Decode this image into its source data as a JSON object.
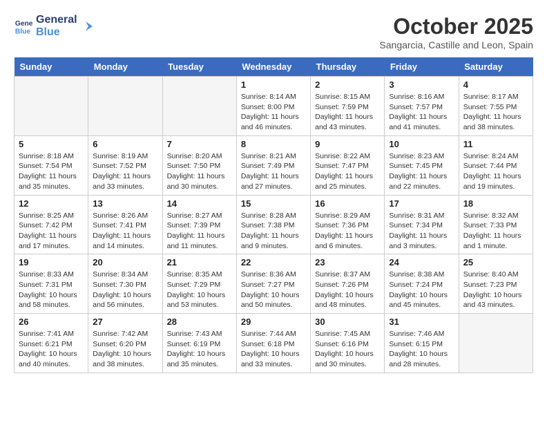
{
  "header": {
    "logo_line1": "General",
    "logo_line2": "Blue",
    "month_year": "October 2025",
    "location": "Sangarcia, Castille and Leon, Spain"
  },
  "weekdays": [
    "Sunday",
    "Monday",
    "Tuesday",
    "Wednesday",
    "Thursday",
    "Friday",
    "Saturday"
  ],
  "weeks": [
    [
      {
        "day": "",
        "empty": true
      },
      {
        "day": "",
        "empty": true
      },
      {
        "day": "",
        "empty": true
      },
      {
        "day": "1",
        "sunrise": "8:14 AM",
        "sunset": "8:00 PM",
        "daylight": "11 hours and 46 minutes."
      },
      {
        "day": "2",
        "sunrise": "8:15 AM",
        "sunset": "7:59 PM",
        "daylight": "11 hours and 43 minutes."
      },
      {
        "day": "3",
        "sunrise": "8:16 AM",
        "sunset": "7:57 PM",
        "daylight": "11 hours and 41 minutes."
      },
      {
        "day": "4",
        "sunrise": "8:17 AM",
        "sunset": "7:55 PM",
        "daylight": "11 hours and 38 minutes."
      }
    ],
    [
      {
        "day": "5",
        "sunrise": "8:18 AM",
        "sunset": "7:54 PM",
        "daylight": "11 hours and 35 minutes."
      },
      {
        "day": "6",
        "sunrise": "8:19 AM",
        "sunset": "7:52 PM",
        "daylight": "11 hours and 33 minutes."
      },
      {
        "day": "7",
        "sunrise": "8:20 AM",
        "sunset": "7:50 PM",
        "daylight": "11 hours and 30 minutes."
      },
      {
        "day": "8",
        "sunrise": "8:21 AM",
        "sunset": "7:49 PM",
        "daylight": "11 hours and 27 minutes."
      },
      {
        "day": "9",
        "sunrise": "8:22 AM",
        "sunset": "7:47 PM",
        "daylight": "11 hours and 25 minutes."
      },
      {
        "day": "10",
        "sunrise": "8:23 AM",
        "sunset": "7:45 PM",
        "daylight": "11 hours and 22 minutes."
      },
      {
        "day": "11",
        "sunrise": "8:24 AM",
        "sunset": "7:44 PM",
        "daylight": "11 hours and 19 minutes."
      }
    ],
    [
      {
        "day": "12",
        "sunrise": "8:25 AM",
        "sunset": "7:42 PM",
        "daylight": "11 hours and 17 minutes."
      },
      {
        "day": "13",
        "sunrise": "8:26 AM",
        "sunset": "7:41 PM",
        "daylight": "11 hours and 14 minutes."
      },
      {
        "day": "14",
        "sunrise": "8:27 AM",
        "sunset": "7:39 PM",
        "daylight": "11 hours and 11 minutes."
      },
      {
        "day": "15",
        "sunrise": "8:28 AM",
        "sunset": "7:38 PM",
        "daylight": "11 hours and 9 minutes."
      },
      {
        "day": "16",
        "sunrise": "8:29 AM",
        "sunset": "7:36 PM",
        "daylight": "11 hours and 6 minutes."
      },
      {
        "day": "17",
        "sunrise": "8:31 AM",
        "sunset": "7:34 PM",
        "daylight": "11 hours and 3 minutes."
      },
      {
        "day": "18",
        "sunrise": "8:32 AM",
        "sunset": "7:33 PM",
        "daylight": "11 hours and 1 minute."
      }
    ],
    [
      {
        "day": "19",
        "sunrise": "8:33 AM",
        "sunset": "7:31 PM",
        "daylight": "10 hours and 58 minutes."
      },
      {
        "day": "20",
        "sunrise": "8:34 AM",
        "sunset": "7:30 PM",
        "daylight": "10 hours and 56 minutes."
      },
      {
        "day": "21",
        "sunrise": "8:35 AM",
        "sunset": "7:29 PM",
        "daylight": "10 hours and 53 minutes."
      },
      {
        "day": "22",
        "sunrise": "8:36 AM",
        "sunset": "7:27 PM",
        "daylight": "10 hours and 50 minutes."
      },
      {
        "day": "23",
        "sunrise": "8:37 AM",
        "sunset": "7:26 PM",
        "daylight": "10 hours and 48 minutes."
      },
      {
        "day": "24",
        "sunrise": "8:38 AM",
        "sunset": "7:24 PM",
        "daylight": "10 hours and 45 minutes."
      },
      {
        "day": "25",
        "sunrise": "8:40 AM",
        "sunset": "7:23 PM",
        "daylight": "10 hours and 43 minutes."
      }
    ],
    [
      {
        "day": "26",
        "sunrise": "7:41 AM",
        "sunset": "6:21 PM",
        "daylight": "10 hours and 40 minutes."
      },
      {
        "day": "27",
        "sunrise": "7:42 AM",
        "sunset": "6:20 PM",
        "daylight": "10 hours and 38 minutes."
      },
      {
        "day": "28",
        "sunrise": "7:43 AM",
        "sunset": "6:19 PM",
        "daylight": "10 hours and 35 minutes."
      },
      {
        "day": "29",
        "sunrise": "7:44 AM",
        "sunset": "6:18 PM",
        "daylight": "10 hours and 33 minutes."
      },
      {
        "day": "30",
        "sunrise": "7:45 AM",
        "sunset": "6:16 PM",
        "daylight": "10 hours and 30 minutes."
      },
      {
        "day": "31",
        "sunrise": "7:46 AM",
        "sunset": "6:15 PM",
        "daylight": "10 hours and 28 minutes."
      },
      {
        "day": "",
        "empty": true
      }
    ]
  ]
}
